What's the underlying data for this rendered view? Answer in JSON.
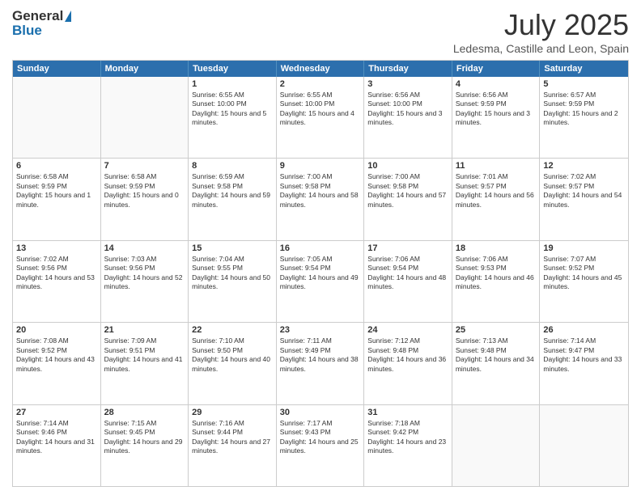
{
  "logo": {
    "general": "General",
    "blue": "Blue"
  },
  "title": {
    "month": "July 2025",
    "location": "Ledesma, Castille and Leon, Spain"
  },
  "header": {
    "days": [
      "Sunday",
      "Monday",
      "Tuesday",
      "Wednesday",
      "Thursday",
      "Friday",
      "Saturday"
    ]
  },
  "weeks": [
    [
      {
        "day": "",
        "empty": true
      },
      {
        "day": "",
        "empty": true
      },
      {
        "day": "1",
        "sunrise": "6:55 AM",
        "sunset": "10:00 PM",
        "daylight": "15 hours and 5 minutes."
      },
      {
        "day": "2",
        "sunrise": "6:55 AM",
        "sunset": "10:00 PM",
        "daylight": "15 hours and 4 minutes."
      },
      {
        "day": "3",
        "sunrise": "6:56 AM",
        "sunset": "10:00 PM",
        "daylight": "15 hours and 3 minutes."
      },
      {
        "day": "4",
        "sunrise": "6:56 AM",
        "sunset": "9:59 PM",
        "daylight": "15 hours and 3 minutes."
      },
      {
        "day": "5",
        "sunrise": "6:57 AM",
        "sunset": "9:59 PM",
        "daylight": "15 hours and 2 minutes."
      }
    ],
    [
      {
        "day": "6",
        "sunrise": "6:58 AM",
        "sunset": "9:59 PM",
        "daylight": "15 hours and 1 minute."
      },
      {
        "day": "7",
        "sunrise": "6:58 AM",
        "sunset": "9:59 PM",
        "daylight": "15 hours and 0 minutes."
      },
      {
        "day": "8",
        "sunrise": "6:59 AM",
        "sunset": "9:58 PM",
        "daylight": "14 hours and 59 minutes."
      },
      {
        "day": "9",
        "sunrise": "7:00 AM",
        "sunset": "9:58 PM",
        "daylight": "14 hours and 58 minutes."
      },
      {
        "day": "10",
        "sunrise": "7:00 AM",
        "sunset": "9:58 PM",
        "daylight": "14 hours and 57 minutes."
      },
      {
        "day": "11",
        "sunrise": "7:01 AM",
        "sunset": "9:57 PM",
        "daylight": "14 hours and 56 minutes."
      },
      {
        "day": "12",
        "sunrise": "7:02 AM",
        "sunset": "9:57 PM",
        "daylight": "14 hours and 54 minutes."
      }
    ],
    [
      {
        "day": "13",
        "sunrise": "7:02 AM",
        "sunset": "9:56 PM",
        "daylight": "14 hours and 53 minutes."
      },
      {
        "day": "14",
        "sunrise": "7:03 AM",
        "sunset": "9:56 PM",
        "daylight": "14 hours and 52 minutes."
      },
      {
        "day": "15",
        "sunrise": "7:04 AM",
        "sunset": "9:55 PM",
        "daylight": "14 hours and 50 minutes."
      },
      {
        "day": "16",
        "sunrise": "7:05 AM",
        "sunset": "9:54 PM",
        "daylight": "14 hours and 49 minutes."
      },
      {
        "day": "17",
        "sunrise": "7:06 AM",
        "sunset": "9:54 PM",
        "daylight": "14 hours and 48 minutes."
      },
      {
        "day": "18",
        "sunrise": "7:06 AM",
        "sunset": "9:53 PM",
        "daylight": "14 hours and 46 minutes."
      },
      {
        "day": "19",
        "sunrise": "7:07 AM",
        "sunset": "9:52 PM",
        "daylight": "14 hours and 45 minutes."
      }
    ],
    [
      {
        "day": "20",
        "sunrise": "7:08 AM",
        "sunset": "9:52 PM",
        "daylight": "14 hours and 43 minutes."
      },
      {
        "day": "21",
        "sunrise": "7:09 AM",
        "sunset": "9:51 PM",
        "daylight": "14 hours and 41 minutes."
      },
      {
        "day": "22",
        "sunrise": "7:10 AM",
        "sunset": "9:50 PM",
        "daylight": "14 hours and 40 minutes."
      },
      {
        "day": "23",
        "sunrise": "7:11 AM",
        "sunset": "9:49 PM",
        "daylight": "14 hours and 38 minutes."
      },
      {
        "day": "24",
        "sunrise": "7:12 AM",
        "sunset": "9:48 PM",
        "daylight": "14 hours and 36 minutes."
      },
      {
        "day": "25",
        "sunrise": "7:13 AM",
        "sunset": "9:48 PM",
        "daylight": "14 hours and 34 minutes."
      },
      {
        "day": "26",
        "sunrise": "7:14 AM",
        "sunset": "9:47 PM",
        "daylight": "14 hours and 33 minutes."
      }
    ],
    [
      {
        "day": "27",
        "sunrise": "7:14 AM",
        "sunset": "9:46 PM",
        "daylight": "14 hours and 31 minutes."
      },
      {
        "day": "28",
        "sunrise": "7:15 AM",
        "sunset": "9:45 PM",
        "daylight": "14 hours and 29 minutes."
      },
      {
        "day": "29",
        "sunrise": "7:16 AM",
        "sunset": "9:44 PM",
        "daylight": "14 hours and 27 minutes."
      },
      {
        "day": "30",
        "sunrise": "7:17 AM",
        "sunset": "9:43 PM",
        "daylight": "14 hours and 25 minutes."
      },
      {
        "day": "31",
        "sunrise": "7:18 AM",
        "sunset": "9:42 PM",
        "daylight": "14 hours and 23 minutes."
      },
      {
        "day": "",
        "empty": true
      },
      {
        "day": "",
        "empty": true
      }
    ]
  ]
}
